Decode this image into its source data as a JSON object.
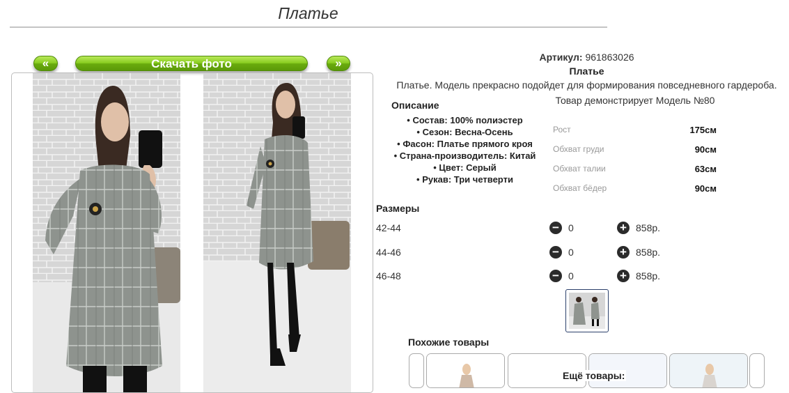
{
  "page": {
    "title": "Платье"
  },
  "gallery": {
    "prev_label": "«",
    "next_label": "»",
    "download_label": "Скачать фото"
  },
  "product": {
    "article_label": "Артикул:",
    "article_value": "961863026",
    "name": "Платье",
    "short_description": "Платье. Модель прекрасно подойдет для формирования повседневного гардероба."
  },
  "description": {
    "heading": "Описание",
    "properties": [
      "Состав: 100% полиэстер",
      "Сезон: Весна-Осень",
      "Фасон: Платье прямого кроя",
      "Страна-производитель: Китай",
      "Цвет: Серый",
      "Рукав: Три четверти"
    ]
  },
  "model": {
    "title": "Товар демонстрирует Модель №80",
    "measurements": [
      {
        "label": "Рост",
        "value": "175см"
      },
      {
        "label": "Обхват груди",
        "value": "90см"
      },
      {
        "label": "Обхват талии",
        "value": "63см"
      },
      {
        "label": "Обхват бёдер",
        "value": "90см"
      }
    ]
  },
  "sizes": {
    "heading": "Размеры",
    "rows": [
      {
        "size": "42-44",
        "qty": "0",
        "price": "858р."
      },
      {
        "size": "44-46",
        "qty": "0",
        "price": "858р."
      },
      {
        "size": "46-48",
        "qty": "0",
        "price": "858р."
      }
    ],
    "minus_symbol": "−",
    "plus_symbol": "+"
  },
  "similar": {
    "heading": "Похожие товары",
    "more_label": "Ещё товары:"
  },
  "colors": {
    "button_green": "#88cc1e",
    "dress_gray": "#8f948f",
    "brick_wall": "#d4d4d4",
    "thumb_border": "#2a3f6a"
  },
  "icons": [
    "minus-circle-icon",
    "plus-circle-icon"
  ]
}
